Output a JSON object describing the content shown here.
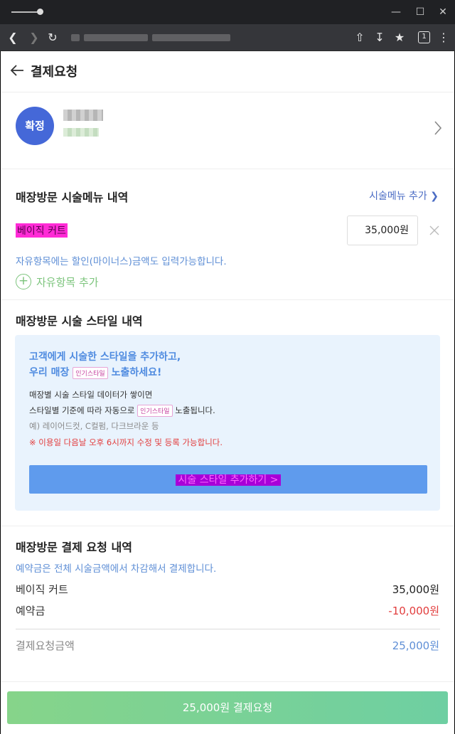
{
  "header": {
    "title": "결제요청"
  },
  "shop": {
    "status_badge": "확정"
  },
  "menu_section": {
    "title": "매장방문 시술메뉴 내역",
    "add_menu_link": "시술메뉴 추가",
    "items": [
      {
        "name": "베이직 커트",
        "price": "35,000원"
      }
    ],
    "hint": "자유항목에는 할인(마이너스)금액도 입력가능합니다.",
    "add_free_item": "자유항목 추가"
  },
  "style_section": {
    "title": "매장방문 시술 스타일 내역",
    "headline_1": "고객에게 시술한 스타일을 추가하고,",
    "headline_2_pre": "우리 매장",
    "headline_2_post": "노출하세요!",
    "popular_tag": "인기스타일",
    "line_1": "매장별 시술 스타일 데이터가 쌓이면",
    "line_2_pre": "스타일별 기준에 따라 자동으로",
    "line_2_post": "노출됩니다.",
    "line_3": "예) 레이어드컷, C컬펌, 다크브라운 등",
    "line_4": "※ 이용일 다음날 오후 6시까지 수정 및 등록 가능합니다.",
    "add_style_button": "시술 스타일 추가하기 >"
  },
  "payment_section": {
    "title": "매장방문 결제 요청 내역",
    "note": "예약금은 전체 시술금액에서 차감해서 결제합니다.",
    "rows": [
      {
        "label": "베이직 커트",
        "value": "35,000원"
      },
      {
        "label": "예약금",
        "value": "-10,000원"
      }
    ],
    "total_label": "결제요청금액",
    "total_value": "25,000원"
  },
  "bottom": {
    "pay_button": "25,000원 결제요청"
  },
  "colors": {
    "accent_blue": "#4568d8",
    "link_blue": "#5f8fd6",
    "green": "#7cc47c",
    "negative": "#e23d3d"
  }
}
